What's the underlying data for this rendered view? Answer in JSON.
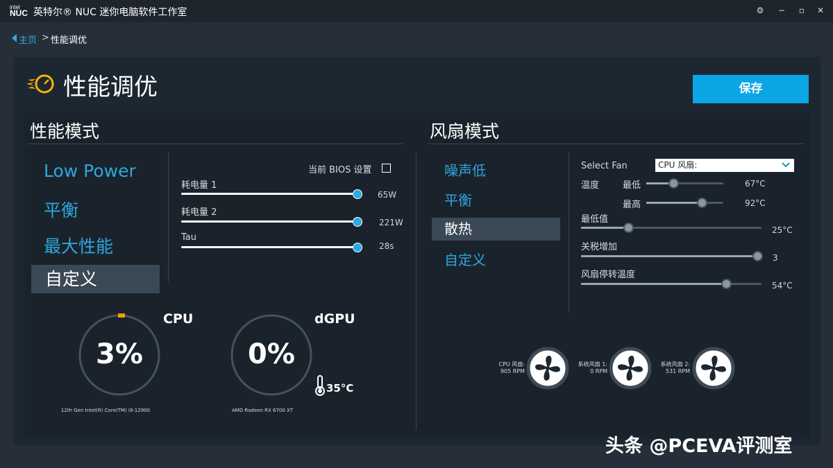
{
  "titlebar": {
    "logo_top": "intel",
    "logo_main": "NUC",
    "title": "英特尔® NUC 迷你电脑软件工作室",
    "gear_glyph": "⚙",
    "min_glyph": "−",
    "max_glyph": "▫",
    "close_glyph": "✕"
  },
  "breadcrumb": {
    "home": "主页",
    "separator": ">",
    "current": "性能调优"
  },
  "page": {
    "title": "性能调优",
    "save_label": "保存"
  },
  "performance": {
    "header": "性能模式",
    "modes": [
      "Low Power",
      "平衡",
      "最大性能",
      "自定义"
    ],
    "selected_mode": "自定义",
    "bios_label": "当前 BIOS 设置",
    "sliders": [
      {
        "label": "耗电量 1",
        "value": "65W",
        "fraction": 1.0
      },
      {
        "label": "耗电量 2",
        "value": "221W",
        "fraction": 1.0
      },
      {
        "label": "Tau",
        "value": "28s",
        "fraction": 1.0
      }
    ]
  },
  "gauges": {
    "cpu": {
      "label": "CPU",
      "value": "3%",
      "percent": 3,
      "device": "12th Gen Intel(R) Core(TM) i9-12900"
    },
    "gpu": {
      "label": "dGPU",
      "value": "0%",
      "percent": 0,
      "device": "AMD Radeon RX 6700 XT",
      "temp": "35°C"
    }
  },
  "fan_mode": {
    "header": "风扇模式",
    "modes": [
      "噪声低",
      "平衡",
      "散热",
      "自定义"
    ],
    "selected_mode": "散热",
    "select_fan_label": "Select Fan",
    "selected_fan": "CPU 风扇:",
    "temp_label": "温度",
    "min_label": "最低",
    "max_label": "最高",
    "temp_min_value": "67°C",
    "temp_max_value": "92°C",
    "minval_label": "最低值",
    "minval_value": "25°C",
    "gain_label": "关税增加",
    "gain_value": "3",
    "stop_label": "风扇停转温度",
    "stop_value": "54°C",
    "fans": [
      {
        "name": "CPU 风扇:",
        "rpm": "905 RPM"
      },
      {
        "name": "系统风扇 1:",
        "rpm": "0 RPM"
      },
      {
        "name": "系统风扇 2:",
        "rpm": "531 RPM"
      }
    ]
  },
  "watermark": "头条 @PCEVA评测室",
  "colors": {
    "accent": "#0aa6e6",
    "link": "#2fa6dd",
    "gauge_marker": "#f0a000"
  }
}
